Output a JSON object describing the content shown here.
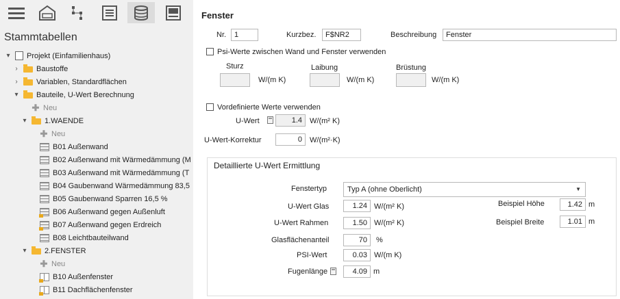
{
  "sidebar": {
    "title": "Stammtabellen",
    "tree": [
      {
        "label": "Projekt (Einfamilienhaus)",
        "icon": "project-icon",
        "expander": "▾",
        "kind": "project",
        "indent": 0
      },
      {
        "label": "Baustoffe",
        "icon": "folder-icon",
        "expander": "›",
        "kind": "folder",
        "indent": 1
      },
      {
        "label": "Variablen, Standardflächen",
        "icon": "folder-icon",
        "expander": "›",
        "kind": "folder",
        "indent": 1
      },
      {
        "label": "Bauteile, U-Wert Berechnung",
        "icon": "folder-icon",
        "expander": "▾",
        "kind": "folder",
        "indent": 1
      },
      {
        "label": "Neu",
        "icon": "plus-icon",
        "expander": "",
        "kind": "new",
        "indent": 2
      },
      {
        "label": "1.WAENDE",
        "icon": "folder-icon",
        "expander": "▾",
        "kind": "folder",
        "indent": 2
      },
      {
        "label": "Neu",
        "icon": "plus-icon",
        "expander": "",
        "kind": "new",
        "indent": 3
      },
      {
        "label": "B01 Außenwand",
        "icon": "wall-icon",
        "expander": "",
        "kind": "wall",
        "indent": 3
      },
      {
        "label": "B02 Außenwand mit Wärmedämmung (M",
        "icon": "wall-icon",
        "expander": "",
        "kind": "wall",
        "indent": 3
      },
      {
        "label": "B03 Außenwand mit Wärmedämmung (T",
        "icon": "wall-icon",
        "expander": "",
        "kind": "wall",
        "indent": 3
      },
      {
        "label": "B04 Gaubenwand Wärmedämmung 83,5",
        "icon": "wall-icon",
        "expander": "",
        "kind": "wall",
        "indent": 3
      },
      {
        "label": "B05 Gaubenwand Sparren 16,5 %",
        "icon": "wall-icon",
        "expander": "",
        "kind": "wall",
        "indent": 3
      },
      {
        "label": "B06 Außenwand gegen Außenluft",
        "icon": "locked-wall-icon",
        "expander": "",
        "kind": "lockwall",
        "indent": 3
      },
      {
        "label": "B07 Außenwand gegen Erdreich",
        "icon": "locked-wall-icon",
        "expander": "",
        "kind": "lockwall",
        "indent": 3
      },
      {
        "label": "B08 Leichtbauteilwand",
        "icon": "wall-icon",
        "expander": "",
        "kind": "wall",
        "indent": 3
      },
      {
        "label": "2.FENSTER",
        "icon": "folder-icon",
        "expander": "▾",
        "kind": "folder",
        "indent": 2
      },
      {
        "label": "Neu",
        "icon": "plus-icon",
        "expander": "",
        "kind": "new",
        "indent": 3
      },
      {
        "label": "B10 Außenfenster",
        "icon": "locked-window-icon",
        "expander": "",
        "kind": "lockwin",
        "indent": 3
      },
      {
        "label": "B11 Dachflächenfenster",
        "icon": "locked-window-icon",
        "expander": "",
        "kind": "lockwin",
        "indent": 3
      }
    ]
  },
  "toolbar": {
    "icons": [
      "menu-icon",
      "building-icon",
      "structure-icon",
      "list-icon",
      "database-icon",
      "window-icon"
    ],
    "active": "database-icon"
  },
  "form": {
    "title": "Fenster",
    "nr_label": "Nr.",
    "nr_value": "1",
    "kurzbez_label": "Kurzbez.",
    "kurzbez_value": "F$NR2",
    "beschreibung_label": "Beschreibung",
    "beschreibung_value": "Fenster",
    "psi_checkbox_label": "Psi-Werte zwischen Wand und Fenster verwenden",
    "sturz_label": "Sturz",
    "laibung_label": "Laibung",
    "bruestung_label": "Brüstung",
    "psi_unit": "W/(m K)",
    "vordefiniert_label": "Vordefinierte Werte verwenden",
    "uwert_label": "U-Wert",
    "uwert_value": "1.4",
    "uwert_unit": "W/(m² K)",
    "korrektur_label": "U-Wert-Korrektur",
    "korrektur_value": "0",
    "korrektur_unit": "W/(m²·K)"
  },
  "detail": {
    "title": "Detaillierte U-Wert Ermittlung",
    "fenstertyp_label": "Fenstertyp",
    "fenstertyp_value": "Typ A (ohne Oberlicht)",
    "uglas_label": "U-Wert Glas",
    "uglas_value": "1.24",
    "urahmen_label": "U-Wert Rahmen",
    "urahmen_value": "1.50",
    "u_unit": "W/(m² K)",
    "glasanteil_label": "Glasflächenanteil",
    "glasanteil_value": "70",
    "glasanteil_unit": "%",
    "psi_label": "PSI-Wert",
    "psi_value": "0.03",
    "psi_unit": "W/(m K)",
    "fugen_label": "Fugenlänge",
    "fugen_value": "4.09",
    "m_unit": "m",
    "hoehe_label": "Beispiel Höhe",
    "hoehe_value": "1.42",
    "breite_label": "Beispiel Breite",
    "breite_value": "1.01"
  }
}
